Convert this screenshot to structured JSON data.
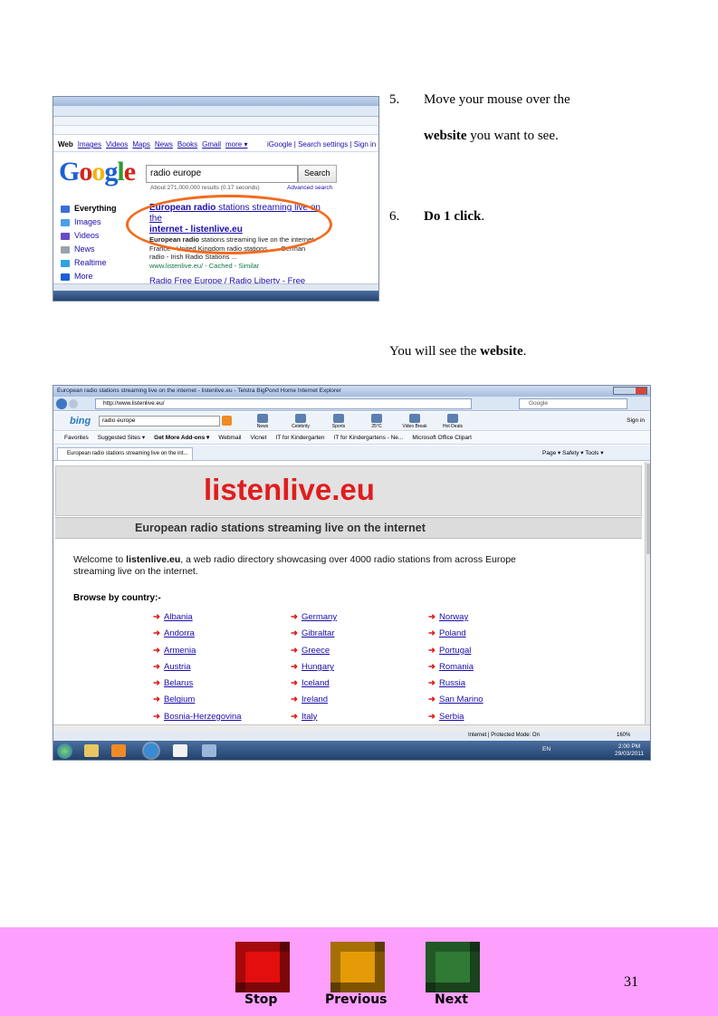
{
  "instructions": {
    "step5_num": "5.",
    "step5_line1": "Move your mouse over the",
    "step5_bold": "website",
    "step5_line2_rest": " you want to see.",
    "step6_num": "6.",
    "step6_text": "Do  1  click",
    "step6_period": ".",
    "result_prefix": "You will see the ",
    "result_bold": "website",
    "result_suffix": "."
  },
  "google_shot": {
    "nav": [
      "Web",
      "Images",
      "Videos",
      "Maps",
      "News",
      "Books",
      "Gmail",
      "more ▾"
    ],
    "nav_right": "iGoogle | Search settings | Sign in",
    "logo": [
      "G",
      "o",
      "o",
      "g",
      "l",
      "e"
    ],
    "logo_colors": [
      "#1a5fd6",
      "#d6241a",
      "#f2b50d",
      "#1a5fd6",
      "#2f9a2f",
      "#d6241a"
    ],
    "query": "radio europe",
    "search_button": "Search",
    "about": "About 271,000,000 results (0.17 seconds)",
    "advanced": "Advanced search",
    "left_items": [
      {
        "label": "Everything",
        "color": "#3b6fd8"
      },
      {
        "label": "Images",
        "color": "#4aa0e6"
      },
      {
        "label": "Videos",
        "color": "#6a4bc6"
      },
      {
        "label": "News",
        "color": "#9aa3ad"
      },
      {
        "label": "Realtime",
        "color": "#2fa3e0"
      },
      {
        "label": "More",
        "color": "#1a5fd6"
      }
    ],
    "result1_title_a": "European radio",
    "result1_title_b": " stations streaming live on the",
    "result1_title_c": "internet - listenlive.eu",
    "result1_snip_a": "European radio",
    "result1_snip_b": " stations streaming live on the internet.",
    "result1_snip_c": "France - United Kingdom radio stations ... - German",
    "result1_snip_d": "radio - Irish Radio Stations ...",
    "result1_url": "www.listenlive.eu/ - Cached - Similar",
    "result2_title": "Radio Free Europe / Radio Liberty - Free"
  },
  "listenlive_shot": {
    "window_title": "European radio stations streaming live on the internet - listenlive.eu - Telstra BigPond Home Internet Explorer",
    "address": "http://www.listenlive.eu/",
    "search_engine": "Google",
    "bing_query": "radio europe",
    "toolbar_items": [
      "News",
      "Celebrity",
      "Sports",
      "25°C",
      "Video Break",
      "Hot Deals"
    ],
    "sign_in": "Sign in",
    "favorites": [
      "Favorites",
      "Suggested Sites ▾",
      "Get More Add-ons ▾",
      "Webmail",
      "Vicnet",
      "IT for Kindergarten",
      "IT for Kindergartens - Ne...",
      "Microsoft Office Clipart"
    ],
    "tab_label": "European radio stations streaming live on the int...",
    "command_bar": "Page ▾  Safety ▾  Tools ▾",
    "site_title": "listenlive.eu",
    "site_subtitle": "European radio stations streaming live on the internet",
    "welcome_a": "Welcome to ",
    "welcome_bold": "listenlive.eu",
    "welcome_b": ", a web radio directory showcasing over 4000 radio stations from across Europe",
    "welcome_c": "streaming live on the internet.",
    "browse": "Browse by country:-",
    "countries_col1": [
      "Albania",
      "Andorra",
      "Armenia",
      "Austria",
      "Belarus",
      "Belgium",
      "Bosnia-Herzegovina"
    ],
    "countries_col2": [
      "Germany",
      "Gibraltar",
      "Greece",
      "Hungary",
      "Iceland",
      "Ireland",
      "Italy"
    ],
    "countries_col3": [
      "Norway",
      "Poland",
      "Portugal",
      "Romania",
      "Russia",
      "San Marino",
      "Serbia"
    ],
    "status": "Internet | Protected Mode: On",
    "zoom": "160%",
    "lang": "EN",
    "clock_time": "2:00 PM",
    "clock_date": "29/03/2011"
  },
  "footer": {
    "stop": "Stop",
    "previous": "Previous",
    "next": "Next",
    "page_number": "31",
    "stop_color": "#e30e0e",
    "previous_color": "#e59a07",
    "next_color": "#2f7a34"
  }
}
